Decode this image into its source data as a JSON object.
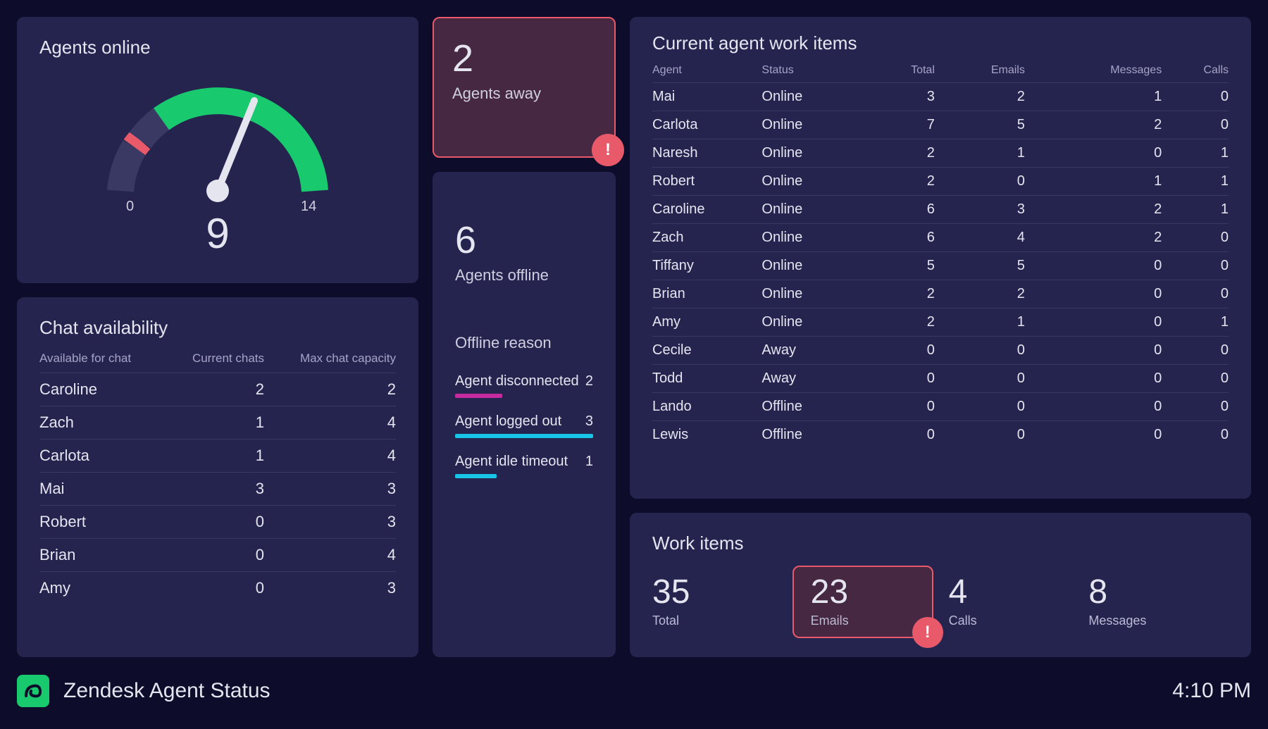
{
  "agents_online": {
    "title": "Agents online",
    "value": "9",
    "min": "0",
    "max": "14"
  },
  "agents_away": {
    "value": "2",
    "label": "Agents away"
  },
  "agents_offline": {
    "value": "6",
    "label": "Agents offline",
    "reason_title": "Offline reason",
    "reasons": [
      {
        "label": "Agent disconnected",
        "count": "2"
      },
      {
        "label": "Agent logged out",
        "count": "3"
      },
      {
        "label": "Agent idle timeout",
        "count": "1"
      }
    ]
  },
  "chat_avail": {
    "title": "Chat availability",
    "headers": {
      "name": "Available for chat",
      "current": "Current chats",
      "max": "Max chat capacity"
    },
    "rows": [
      {
        "name": "Caroline",
        "current": "2",
        "max": "2"
      },
      {
        "name": "Zach",
        "current": "1",
        "max": "4"
      },
      {
        "name": "Carlota",
        "current": "1",
        "max": "4"
      },
      {
        "name": "Mai",
        "current": "3",
        "max": "3"
      },
      {
        "name": "Robert",
        "current": "0",
        "max": "3"
      },
      {
        "name": "Brian",
        "current": "0",
        "max": "4"
      },
      {
        "name": "Amy",
        "current": "0",
        "max": "3"
      }
    ]
  },
  "current_items": {
    "title": "Current agent work items",
    "headers": {
      "agent": "Agent",
      "status": "Status",
      "total": "Total",
      "emails": "Emails",
      "messages": "Messages",
      "calls": "Calls"
    },
    "rows": [
      {
        "agent": "Mai",
        "status": "Online",
        "total": "3",
        "emails": "2",
        "messages": "1",
        "calls": "0"
      },
      {
        "agent": "Carlota",
        "status": "Online",
        "total": "7",
        "emails": "5",
        "messages": "2",
        "calls": "0"
      },
      {
        "agent": "Naresh",
        "status": "Online",
        "total": "2",
        "emails": "1",
        "messages": "0",
        "calls": "1"
      },
      {
        "agent": "Robert",
        "status": "Online",
        "total": "2",
        "emails": "0",
        "messages": "1",
        "calls": "1"
      },
      {
        "agent": "Caroline",
        "status": "Online",
        "total": "6",
        "emails": "3",
        "messages": "2",
        "calls": "1"
      },
      {
        "agent": "Zach",
        "status": "Online",
        "total": "6",
        "emails": "4",
        "messages": "2",
        "calls": "0"
      },
      {
        "agent": "Tiffany",
        "status": "Online",
        "total": "5",
        "emails": "5",
        "messages": "0",
        "calls": "0"
      },
      {
        "agent": "Brian",
        "status": "Online",
        "total": "2",
        "emails": "2",
        "messages": "0",
        "calls": "0"
      },
      {
        "agent": "Amy",
        "status": "Online",
        "total": "2",
        "emails": "1",
        "messages": "0",
        "calls": "1"
      },
      {
        "agent": "Cecile",
        "status": "Away",
        "total": "0",
        "emails": "0",
        "messages": "0",
        "calls": "0"
      },
      {
        "agent": "Todd",
        "status": "Away",
        "total": "0",
        "emails": "0",
        "messages": "0",
        "calls": "0"
      },
      {
        "agent": "Lando",
        "status": "Offline",
        "total": "0",
        "emails": "0",
        "messages": "0",
        "calls": "0"
      },
      {
        "agent": "Lewis",
        "status": "Offline",
        "total": "0",
        "emails": "0",
        "messages": "0",
        "calls": "0"
      }
    ]
  },
  "work_items": {
    "title": "Work items",
    "blocks": [
      {
        "value": "35",
        "label": "Total"
      },
      {
        "value": "23",
        "label": "Emails",
        "alert": true
      },
      {
        "value": "4",
        "label": "Calls"
      },
      {
        "value": "8",
        "label": "Messages"
      }
    ]
  },
  "footer": {
    "title": "Zendesk Agent Status",
    "time": "4:10 PM"
  },
  "chart_data": {
    "type": "gauge",
    "title": "Agents online",
    "value": 9,
    "min": 0,
    "max": 14,
    "segments": [
      {
        "color": "#3a3964",
        "from": 0,
        "to": 2.2
      },
      {
        "color": "#e85a6a",
        "from": 2.2,
        "to": 2.6
      },
      {
        "color": "#3a3964",
        "from": 2.6,
        "to": 3.8
      },
      {
        "color": "#18c96e",
        "from": 3.8,
        "to": 14
      }
    ]
  }
}
